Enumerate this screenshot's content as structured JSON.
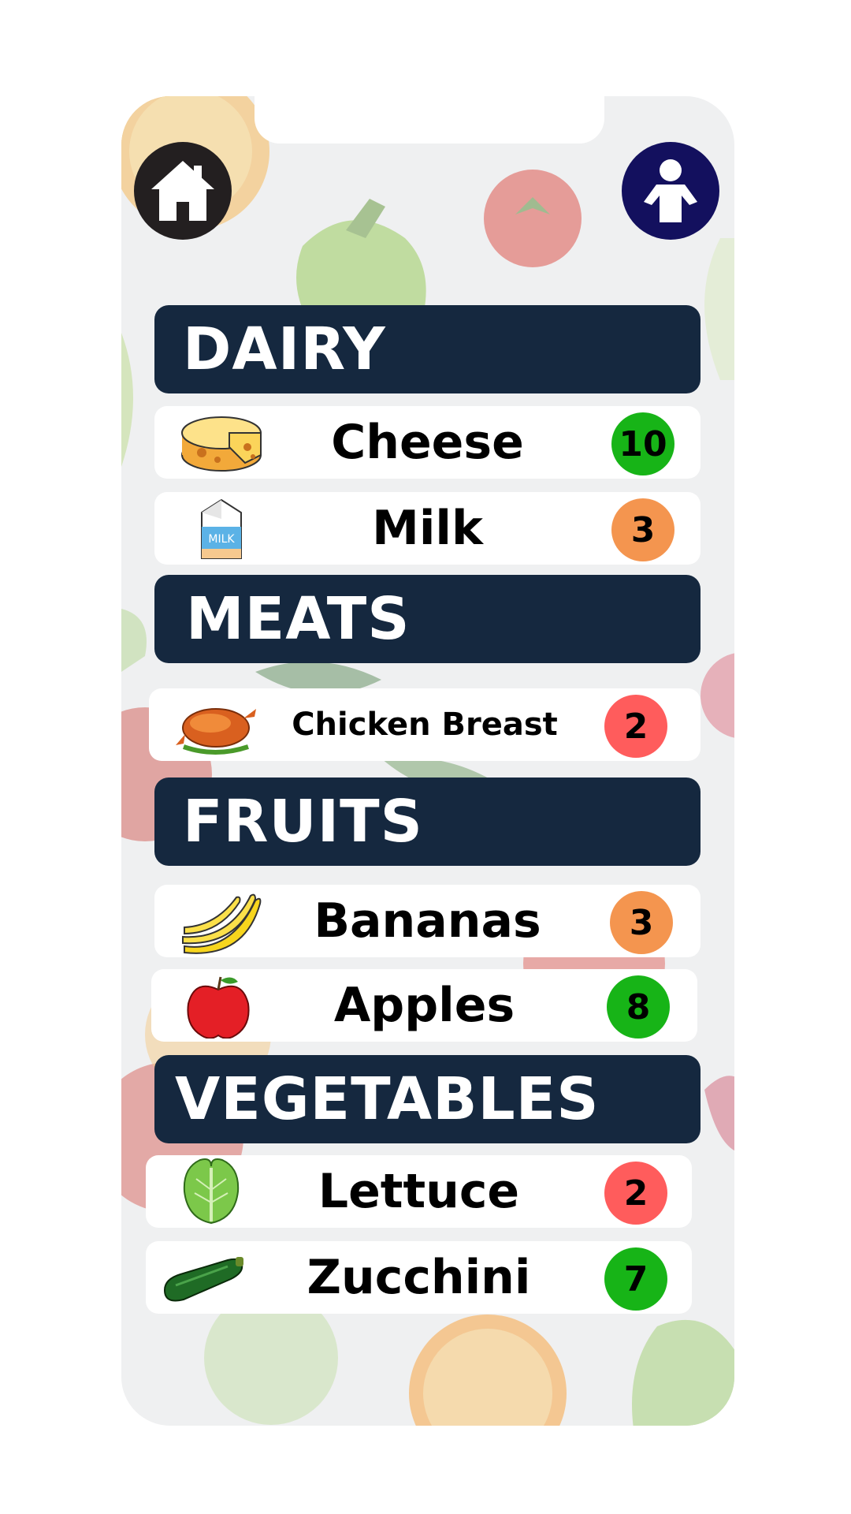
{
  "nav": {
    "home_icon": "home-icon",
    "profile_icon": "person-icon"
  },
  "colors": {
    "header_bg": "#15283f",
    "badge_green": "#17b417",
    "badge_orange": "#f4954f",
    "badge_red": "#ff5c5c"
  },
  "sections": [
    {
      "title": "DAIRY",
      "items": [
        {
          "name": "Cheese",
          "icon": "cheese-icon",
          "count": "10",
          "status": "green"
        },
        {
          "name": "Milk",
          "icon": "milk-carton-icon",
          "count": "3",
          "status": "orange"
        }
      ]
    },
    {
      "title": "MEATS",
      "items": [
        {
          "name": "Chicken Breast",
          "icon": "roast-chicken-icon",
          "count": "2",
          "status": "red"
        }
      ]
    },
    {
      "title": "FRUITS",
      "items": [
        {
          "name": "Bananas",
          "icon": "banana-icon",
          "count": "3",
          "status": "orange"
        },
        {
          "name": "Apples",
          "icon": "apple-icon",
          "count": "8",
          "status": "green"
        }
      ]
    },
    {
      "title": "VEGETABLES",
      "items": [
        {
          "name": "Lettuce",
          "icon": "lettuce-icon",
          "count": "2",
          "status": "red"
        },
        {
          "name": "Zucchini",
          "icon": "zucchini-icon",
          "count": "7",
          "status": "green"
        }
      ]
    }
  ]
}
